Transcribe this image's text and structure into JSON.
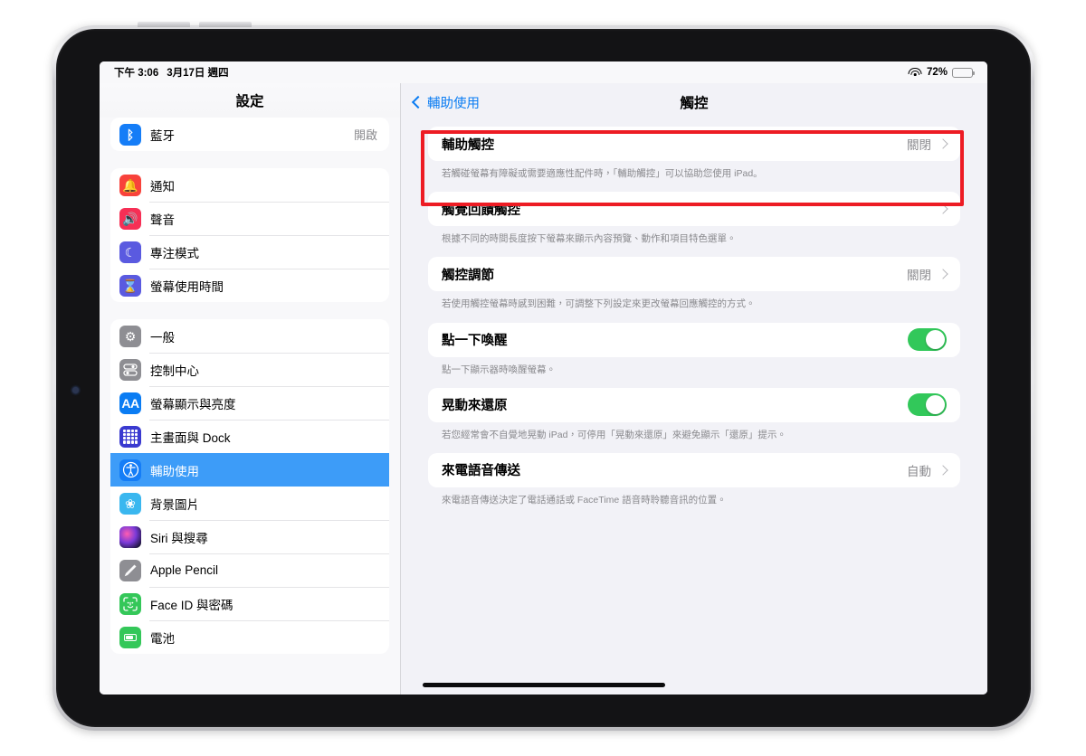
{
  "status_bar": {
    "time": "下午 3:06",
    "date": "3月17日 週四",
    "wifi_icon": "wifi-icon",
    "battery_percent": "72%",
    "battery_level": 72
  },
  "sidebar": {
    "title": "設定",
    "groups": [
      {
        "items": [
          {
            "label": "藍牙",
            "value": "開啟",
            "icon": "bluetooth-icon",
            "icon_class": "icon-bt",
            "glyph": "ᛒ",
            "selected": false
          }
        ]
      },
      {
        "items": [
          {
            "label": "通知",
            "value": "",
            "icon": "bell-icon",
            "icon_class": "icon-notif",
            "glyph": "🔔",
            "selected": false
          },
          {
            "label": "聲音",
            "value": "",
            "icon": "speaker-icon",
            "icon_class": "icon-sound",
            "glyph": "🔊",
            "selected": false
          },
          {
            "label": "專注模式",
            "value": "",
            "icon": "moon-icon",
            "icon_class": "icon-focus",
            "glyph": "☾",
            "selected": false
          },
          {
            "label": "螢幕使用時間",
            "value": "",
            "icon": "hourglass-icon",
            "icon_class": "icon-screentime",
            "glyph": "⌛",
            "selected": false
          }
        ]
      },
      {
        "items": [
          {
            "label": "一般",
            "value": "",
            "icon": "gear-icon",
            "icon_class": "icon-general",
            "glyph": "⚙",
            "selected": false
          },
          {
            "label": "控制中心",
            "value": "",
            "icon": "control-center-icon",
            "icon_class": "icon-control",
            "glyph": "",
            "selected": false
          },
          {
            "label": "螢幕顯示與亮度",
            "value": "",
            "icon": "display-brightness-icon",
            "icon_class": "icon-display",
            "glyph": "AA",
            "selected": false
          },
          {
            "label": "主畫面與 Dock",
            "value": "",
            "icon": "home-screen-icon",
            "icon_class": "icon-home",
            "glyph": "",
            "selected": false
          },
          {
            "label": "輔助使用",
            "value": "",
            "icon": "accessibility-icon",
            "icon_class": "icon-access",
            "glyph": "",
            "selected": true
          },
          {
            "label": "背景圖片",
            "value": "",
            "icon": "wallpaper-icon",
            "icon_class": "icon-wallpaper",
            "glyph": "❀",
            "selected": false
          },
          {
            "label": "Siri 與搜尋",
            "value": "",
            "icon": "siri-icon",
            "icon_class": "icon-siri",
            "glyph": "",
            "selected": false
          },
          {
            "label": "Apple Pencil",
            "value": "",
            "icon": "pencil-icon",
            "icon_class": "icon-pencil",
            "glyph": "",
            "selected": false
          },
          {
            "label": "Face ID 與密碼",
            "value": "",
            "icon": "faceid-icon",
            "icon_class": "icon-faceid",
            "glyph": "",
            "selected": false
          },
          {
            "label": "電池",
            "value": "",
            "icon": "battery-icon",
            "icon_class": "icon-battery",
            "glyph": "",
            "selected": false
          }
        ]
      }
    ]
  },
  "detail": {
    "back_label": "輔助使用",
    "title": "觸控",
    "rows": [
      {
        "title": "輔助觸控",
        "value": "關閉",
        "type": "disclosure",
        "footnote": "若觸碰螢幕有障礙或需要適應性配件時，「輔助觸控」可以協助您使用 iPad。",
        "highlighted": true
      },
      {
        "title": "觸覺回饋觸控",
        "value": "",
        "type": "disclosure",
        "footnote": "根據不同的時間長度按下螢幕來顯示內容預覽、動作和項目特色選單。",
        "highlighted": false
      },
      {
        "title": "觸控調節",
        "value": "關閉",
        "type": "disclosure",
        "footnote": "若使用觸控螢幕時感到困難，可調整下列設定來更改螢幕回應觸控的方式。",
        "highlighted": false
      },
      {
        "title": "點一下喚醒",
        "value": "",
        "type": "toggle",
        "toggle_on": true,
        "footnote": "點一下顯示器時喚醒螢幕。",
        "highlighted": false
      },
      {
        "title": "晃動來還原",
        "value": "",
        "type": "toggle",
        "toggle_on": true,
        "footnote": "若您經常會不自覺地晃動 iPad，可停用「晃動來還原」來避免顯示「還原」提示。",
        "highlighted": false
      },
      {
        "title": "來電語音傳送",
        "value": "自動",
        "type": "disclosure",
        "footnote": "來電語音傳送決定了電話通話或 FaceTime 語音時聆聽音訊的位置。",
        "highlighted": false
      }
    ]
  },
  "colors": {
    "accent_blue": "#0a7cf3",
    "selected_row_blue": "#3d9cf8",
    "toggle_green": "#32c85a",
    "annotation_red": "#ed1c24",
    "screen_background": "#f2f2f7"
  }
}
